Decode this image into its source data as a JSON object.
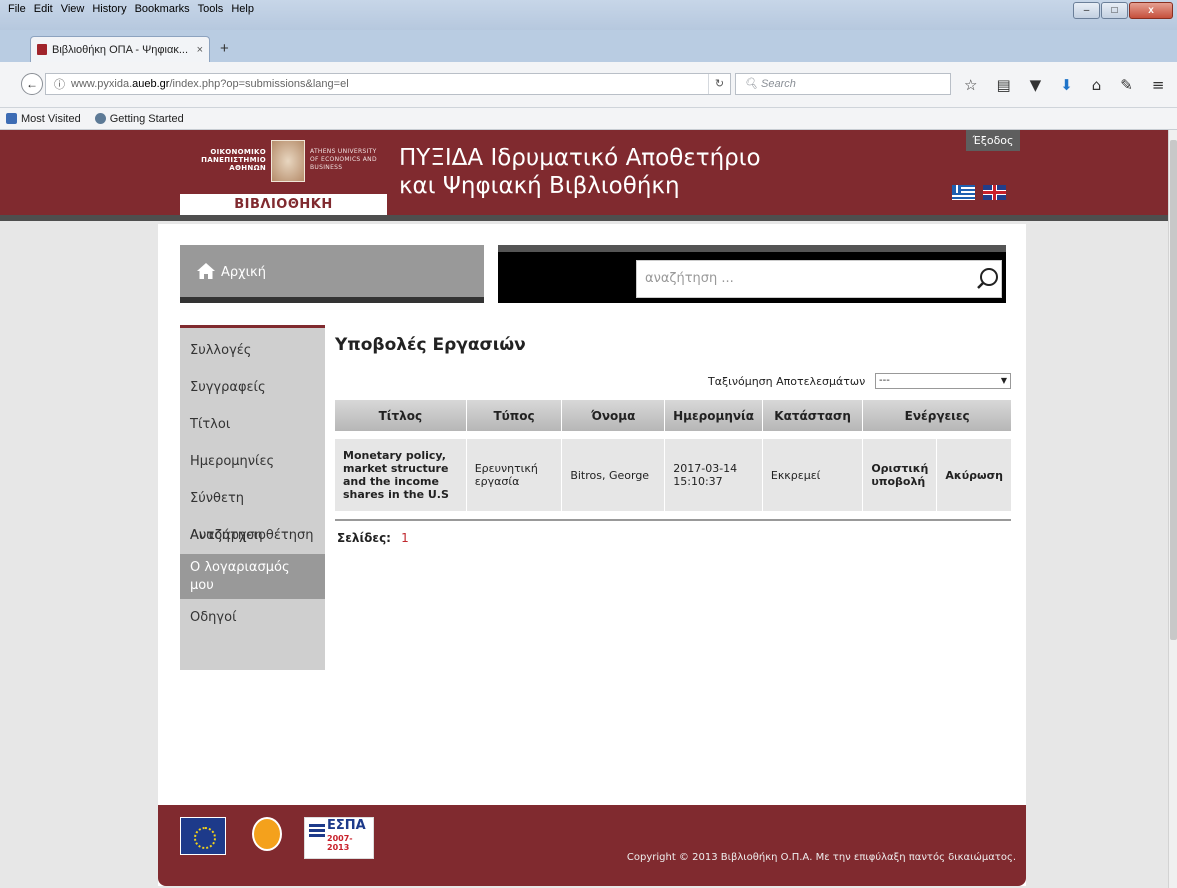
{
  "browser": {
    "menu": [
      "File",
      "Edit",
      "View",
      "History",
      "Bookmarks",
      "Tools",
      "Help"
    ],
    "tab_title": "Βιβλιοθήκη ΟΠΑ - Ψηφιακ...",
    "url_prefix": "www.pyxida.",
    "url_host": "aueb.gr",
    "url_path": "/index.php?op=submissions&lang=el",
    "search_placeholder": "Search",
    "bookmarks": [
      "Most Visited",
      "Getting Started"
    ]
  },
  "header": {
    "aueb_gr": "ΟΙΚΟΝΟΜΙΚΟ ΠΑΝΕΠΙΣΤΗΜΙΟ ΑΘΗΝΩΝ",
    "aueb_en": "ATHENS UNIVERSITY OF ECONOMICS AND BUSINESS",
    "library_label": "ΒΙΒΛΙΟΘΗΚΗ",
    "title_line1": "ΠΥΞΙΔΑ Ιδρυματικό Αποθετήριο",
    "title_line2": "και Ψηφιακή Βιβλιοθήκη",
    "logout": "Έξοδος"
  },
  "nav": {
    "home": "Αρχική",
    "search_placeholder": "αναζήτηση ..."
  },
  "sidebar": {
    "items": [
      {
        "label": "Συλλογές"
      },
      {
        "label": "Συγγραφείς"
      },
      {
        "label": "Τίτλοι"
      },
      {
        "label": "Ημερομηνίες"
      },
      {
        "label": "Σύνθετη Αναζήτηση"
      },
      {
        "label": "Αυτοαρχειοθέτηση"
      },
      {
        "label": "Ο λογαριασμός μου"
      },
      {
        "label": "Οδηγοί"
      }
    ]
  },
  "main": {
    "title": "Υποβολές Εργασιών",
    "sort_label": "Ταξινόμηση Αποτελεσμάτων",
    "sort_value": "---",
    "columns": [
      "Τίτλος",
      "Τύπος",
      "Όνομα",
      "Ημερομηνία",
      "Κατάσταση",
      "Ενέργειες"
    ],
    "rows": [
      {
        "title": "Monetary policy, market structure and the income shares in the U.S",
        "type": "Ερευνητική εργασία",
        "name": "Bitros, George",
        "date": "2017-03-14 15:10:37",
        "status": "Εκκρεμεί",
        "action_submit": "Οριστική υποβολή",
        "action_cancel": "Ακύρωση"
      }
    ],
    "pages_label": "Σελίδες:",
    "page_number": "1"
  },
  "footer": {
    "copyright": "Copyright © 2013 Βιβλιοθήκη Ο.Π.Α. Με την επιφύλαξη παντός δικαιώματος.",
    "espa_text": "ΕΣΠΑ",
    "espa_years": "2007-2013"
  },
  "colors": {
    "brand": "#802a2f",
    "sidebar": "#cfcfcf",
    "accent_page": "#c0282e"
  }
}
